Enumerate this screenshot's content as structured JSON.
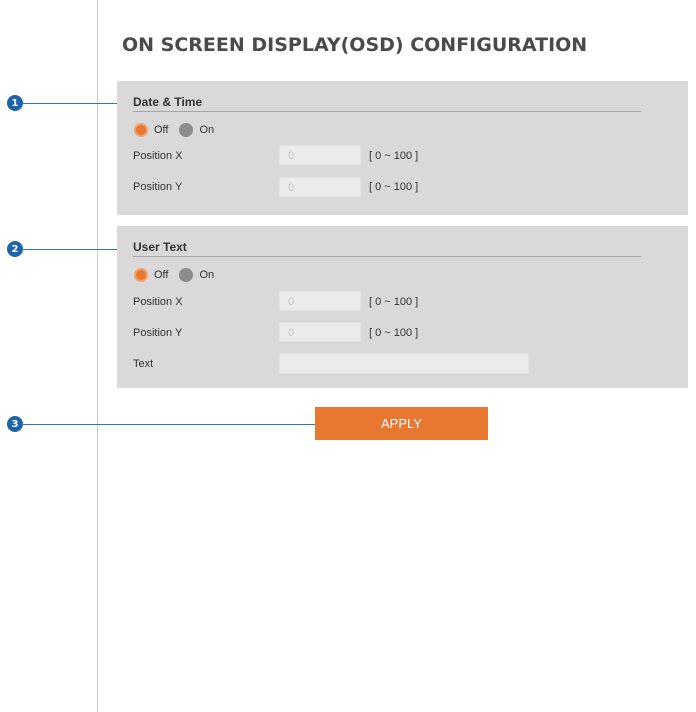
{
  "page": {
    "title": "ON SCREEN DISPLAY(OSD) CONFIGURATION"
  },
  "date_time": {
    "heading": "Date & Time",
    "radio_off": "Off",
    "radio_on": "On",
    "selected": "Off",
    "position_x_label": "Position X",
    "position_x_value": "0",
    "position_x_range": "[ 0 ~ 100 ]",
    "position_y_label": "Position Y",
    "position_y_value": "0",
    "position_y_range": "[ 0 ~ 100 ]"
  },
  "user_text": {
    "heading": "User Text",
    "radio_off": "Off",
    "radio_on": "On",
    "selected": "Off",
    "position_x_label": "Position X",
    "position_x_value": "0",
    "position_x_range": "[ 0 ~ 100 ]",
    "position_y_label": "Position Y",
    "position_y_value": "0",
    "position_y_range": "[ 0 ~ 100 ]",
    "text_label": "Text",
    "text_value": ""
  },
  "apply_button": {
    "label": "APPLY"
  },
  "callouts": [
    "1",
    "2",
    "3"
  ],
  "colors": {
    "accent": "#e8782f",
    "panel": "#d9d9d9",
    "callout": "#1e64ab",
    "radio_unselected": "#8c8c8c"
  }
}
